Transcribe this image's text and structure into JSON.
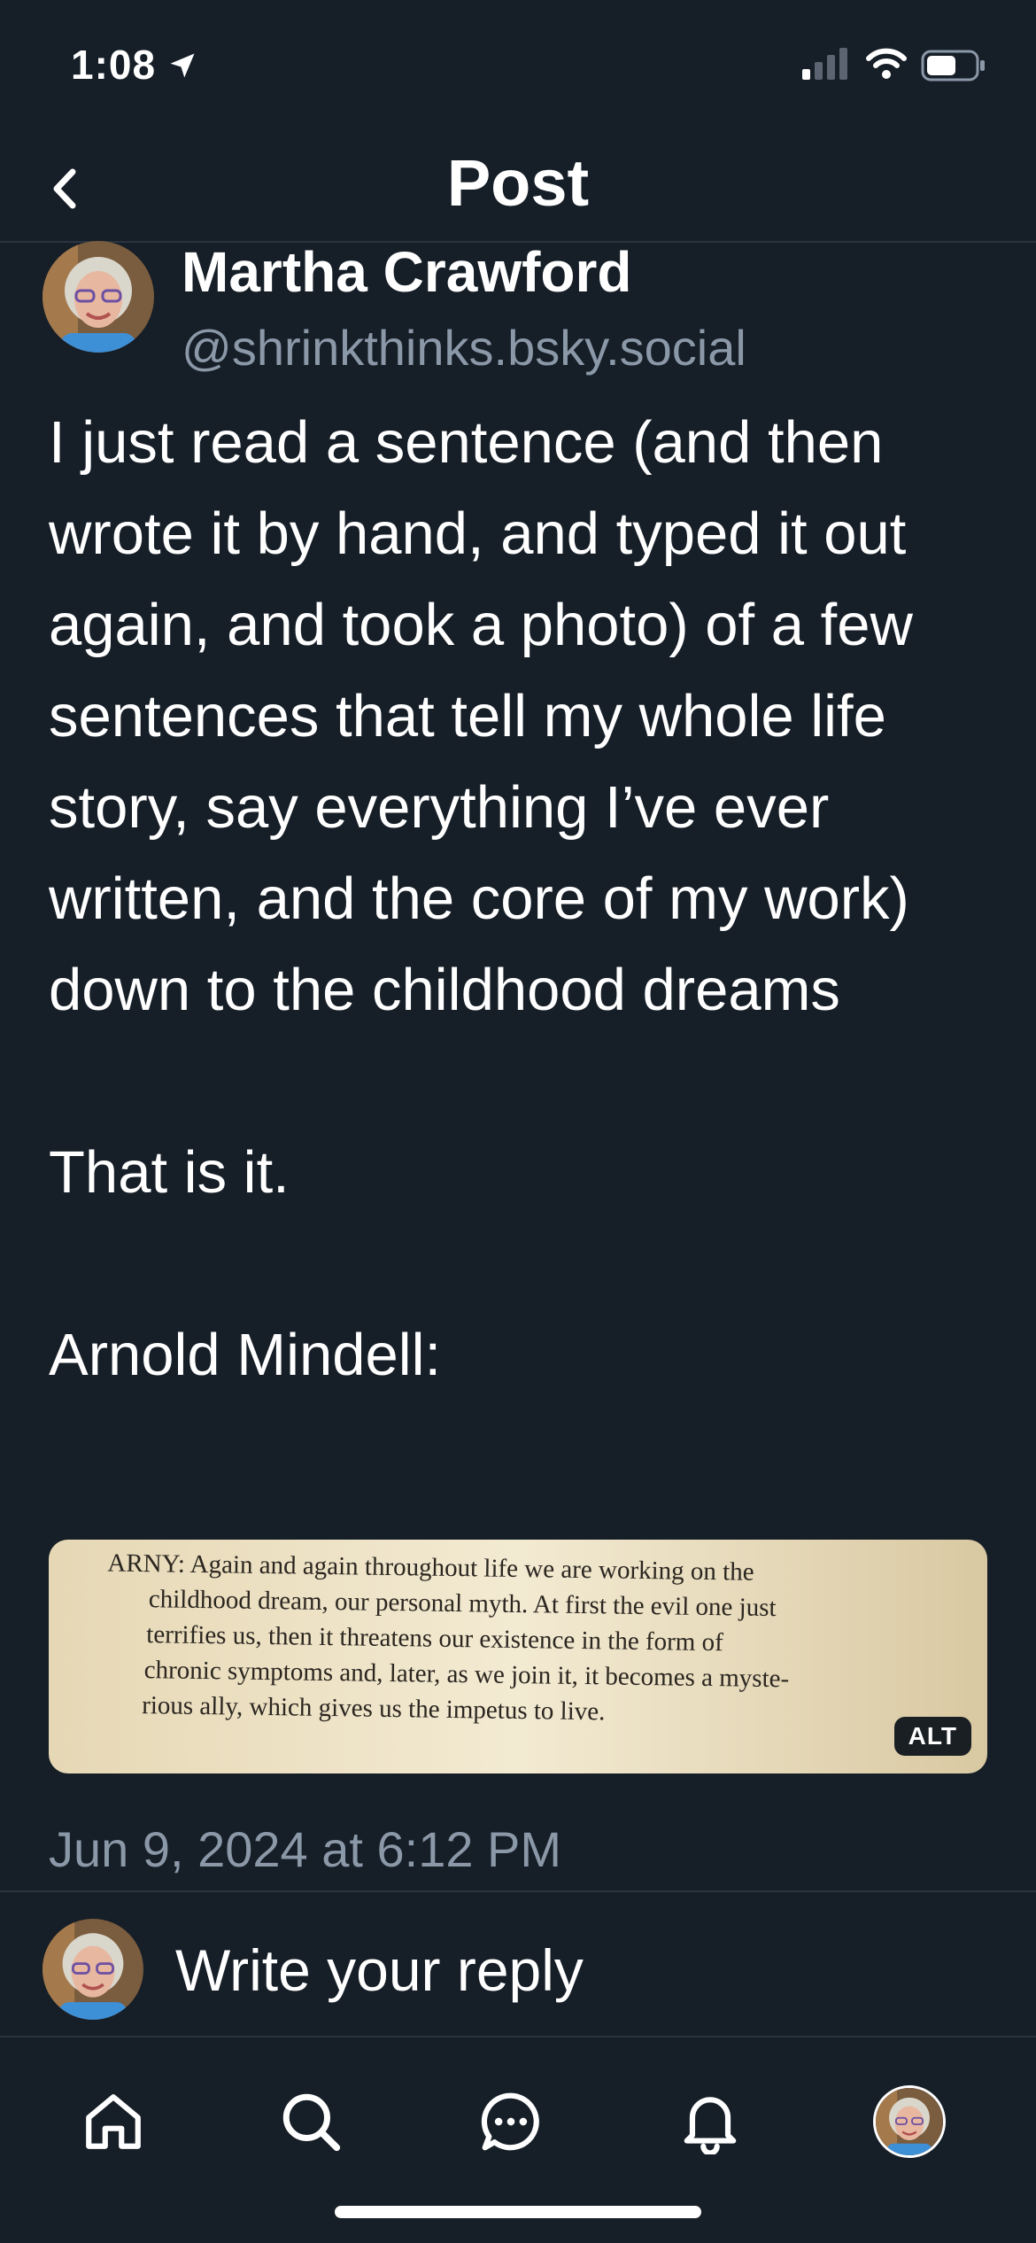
{
  "status_bar": {
    "time": "1:08",
    "icons": [
      "location-arrow-icon",
      "signal-icon",
      "wifi-icon",
      "battery-icon"
    ]
  },
  "header": {
    "title": "Post",
    "back_icon": "chevron-left-icon"
  },
  "post": {
    "author_name": "Martha Crawford",
    "author_handle": "@shrinkthinks.bsky.social",
    "paragraphs": [
      "I just read a sentence (and then wrote it by hand, and typed it out again, and took a photo) of a few sentences that tell my whole life story, say everything I’ve ever written, and the core of my work) down to the childhood dreams",
      "That is it.",
      "Arnold Mindell:"
    ],
    "image": {
      "lines": [
        "ARNY: Again and again throughout life we are working on the",
        "childhood dream, our personal myth. At first the evil one just",
        "terrifies us, then it threatens our existence in the form of",
        "chronic symptoms and, later, as we join it, it becomes a myste-",
        "rious ally, which gives us the impetus to live."
      ],
      "alt_label": "ALT"
    },
    "timestamp": "Jun 9, 2024 at 6:12 PM"
  },
  "reply": {
    "placeholder": "Write your reply"
  },
  "bottom_nav": {
    "items": [
      "home-icon",
      "search-icon",
      "chat-icon",
      "bell-icon",
      "profile-avatar"
    ]
  },
  "colors": {
    "background": "#161e27",
    "text_primary": "#ffffff",
    "text_secondary": "#8b98a8",
    "divider": "#2a3440"
  }
}
